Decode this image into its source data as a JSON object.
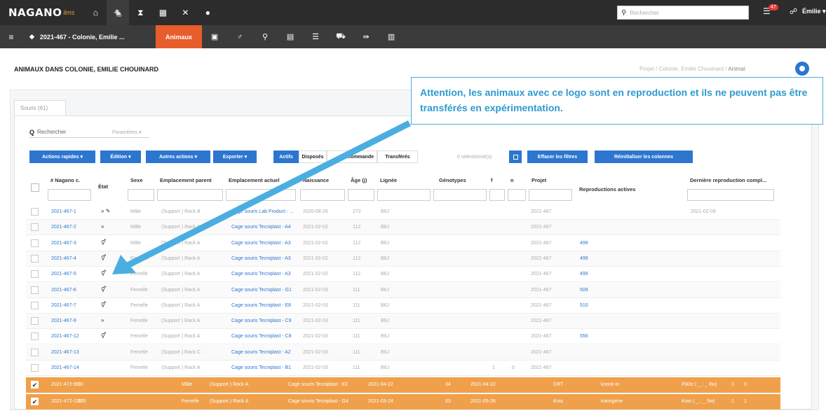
{
  "app": {
    "logo": "NAGANO",
    "logo_sub": "lims"
  },
  "topbar": {
    "icons": [
      "home-icon",
      "rodent-icon",
      "flask-icon",
      "grid-icon",
      "tools-icon",
      "help-icon"
    ],
    "search_placeholder": "Rechercher",
    "notif_count": "47",
    "user": "Émilie ▾"
  },
  "secbar": {
    "project": "2021-467 - Colonie, Emilie ...",
    "active_tab": "Animaux",
    "icons": [
      "calendar-icon",
      "male-icon",
      "location-icon",
      "calendar2-icon",
      "list-icon",
      "cart-icon",
      "transfer-icon",
      "report-icon"
    ]
  },
  "page": {
    "title": "ANIMAUX DANS COLONIE, EMILIE CHOUINARD",
    "breadcrumb": [
      "Projet",
      "Colonie, Emilie Chouinard",
      "Animal"
    ]
  },
  "tab": {
    "label": "Souris (61)"
  },
  "search": {
    "label": "Rechercher",
    "params": "Paramètres ▾"
  },
  "toolbar": {
    "actions_rapides": "Actions rapides ▾",
    "edition": "Édition ▾",
    "autres_actions": "Autres actions ▾",
    "exporter": "Exporter ▾",
    "actifs": "Actifs",
    "disposes": "Disposés",
    "commande": "commande",
    "transferes": "Transférés",
    "selected": "0 sélectionné(s)",
    "effacer": "Effacer les filtres",
    "reinit": "Réinitialiser les colonnes"
  },
  "headers": {
    "nagano": "# Nagano c.",
    "etat": "État",
    "sexe": "Sexe",
    "parent": "Emplacement parent",
    "actuel": "Emplacement actuel",
    "naissance": "Naissance",
    "age": "Âge (j)",
    "lignee": "Lignée",
    "genotypes": "Génotypes",
    "f": "f",
    "n": "n",
    "projet": "Projet",
    "repro": "Reproductions actives",
    "derniere": "Dernière reproduction compl..."
  },
  "rows": [
    {
      "id": "2021-467-1",
      "etat": "»  ✎",
      "sexe": "Mâle",
      "parent": "(Support ) Rack B",
      "actuel": "Cage souris Lab Product - ...",
      "naissance": "2020-08-26",
      "age": "272",
      "lignee": "B6J",
      "f": "",
      "n": "",
      "projet": "2021-467",
      "repro": "",
      "derniere": "2021-02-09"
    },
    {
      "id": "2021-467-2",
      "etat": "»",
      "sexe": "Mâle",
      "parent": "(Support ) Rack A",
      "actuel": "Cage souris Tecniplast - A4",
      "naissance": "2021-02-02",
      "age": "112",
      "lignee": "B6J",
      "f": "",
      "n": "",
      "projet": "2021-467",
      "repro": "",
      "derniere": ""
    },
    {
      "id": "2021-467-3",
      "etat": "⚥",
      "sexe": "Mâle",
      "parent": "(Support ) Rack A",
      "actuel": "Cage souris Tecniplast - A3",
      "naissance": "2021-02-02",
      "age": "112",
      "lignee": "B6J",
      "f": "",
      "n": "",
      "projet": "2021-467",
      "repro": "499",
      "derniere": ""
    },
    {
      "id": "2021-467-4",
      "etat": "⚥",
      "sexe": "Femelle",
      "parent": "(Support ) Rack A",
      "actuel": "Cage souris Tecniplast - A3",
      "naissance": "2021-02-02",
      "age": "112",
      "lignee": "B6J",
      "f": "",
      "n": "",
      "projet": "2021-467",
      "repro": "499",
      "derniere": ""
    },
    {
      "id": "2021-467-5",
      "etat": "⚥",
      "sexe": "Femelle",
      "parent": "(Support ) Rack A",
      "actuel": "Cage souris Tecniplast - A3",
      "naissance": "2021-02-02",
      "age": "112",
      "lignee": "B6J",
      "f": "",
      "n": "",
      "projet": "2021-467",
      "repro": "499",
      "derniere": ""
    },
    {
      "id": "2021-467-6",
      "etat": "⚥",
      "sexe": "Femelle",
      "parent": "(Support ) Rack A",
      "actuel": "Cage souris Tecniplast - G1",
      "naissance": "2021-02-03",
      "age": "111",
      "lignee": "B6J",
      "f": "",
      "n": "",
      "projet": "2021-467",
      "repro": "509",
      "derniere": ""
    },
    {
      "id": "2021-467-7",
      "etat": "⚥",
      "sexe": "Femelle",
      "parent": "(Support ) Rack A",
      "actuel": "Cage souris Tecniplast - E8",
      "naissance": "2021-02-03",
      "age": "111",
      "lignee": "B6J",
      "f": "",
      "n": "",
      "projet": "2021-467",
      "repro": "510",
      "derniere": ""
    },
    {
      "id": "2021-467-9",
      "etat": "»",
      "sexe": "Femelle",
      "parent": "(Support ) Rack A",
      "actuel": "Cage souris Tecniplast - C9",
      "naissance": "2021-02-03",
      "age": "111",
      "lignee": "B6J",
      "f": "",
      "n": "",
      "projet": "2021-467",
      "repro": "",
      "derniere": ""
    },
    {
      "id": "2021-467-12",
      "etat": "⚥",
      "sexe": "Femelle",
      "parent": "(Support ) Rack A",
      "actuel": "Cage souris Tecniplast - C8",
      "naissance": "2021-02-03",
      "age": "111",
      "lignee": "B6J",
      "f": "",
      "n": "",
      "projet": "2021-467",
      "repro": "556",
      "derniere": ""
    },
    {
      "id": "2021-467-13",
      "etat": "",
      "sexe": "Femelle",
      "parent": "(Support ) Rack C",
      "actuel": "Cage souris Tecniplast - A2",
      "naissance": "2021-02-03",
      "age": "111",
      "lignee": "B6J",
      "f": "",
      "n": "",
      "projet": "2021-467",
      "repro": "",
      "derniere": ""
    },
    {
      "id": "2021-467-14",
      "etat": "",
      "sexe": "Femelle",
      "parent": "(Support ) Rack A",
      "actuel": "Cage souris Tecniplast - B1",
      "naissance": "2021-02-03",
      "age": "111",
      "lignee": "B6J",
      "f": "1",
      "n": "0",
      "projet": "2021-467",
      "repro": "",
      "derniere": ""
    }
  ],
  "selected_rows": [
    {
      "id": "2021-472-90",
      "num": "90",
      "sexe": "Mâle",
      "parent": "(Support ) Rack A",
      "actuel": "Cage souris Tecniplast - E2",
      "naissance": "2021-04-22",
      "age": "34",
      "date2": "2021-04-22",
      "projet": "CRT",
      "type": "knock-in",
      "geno": "Fbl3c ( _ ; _ /tw)",
      "f": "1",
      "n": "0"
    },
    {
      "id": "2021-472-105",
      "num": "105",
      "sexe": "Femelle",
      "parent": "(Support ) Rack A",
      "actuel": "Cage souris Tecniplast - G4",
      "naissance": "2021-03-24",
      "age": "63",
      "date2": "2021-05-26",
      "projet": "Kras",
      "type": "transgène",
      "geno": "Kras ( _ ; _ /tw)",
      "f": "1",
      "n": "1"
    }
  ],
  "callout": {
    "text": "Attention, les animaux avec ce logo sont en reproduction et ils ne peuvent pas être transférés en expérimentation."
  },
  "colors": {
    "accent": "#2d76cf",
    "brand_orange": "#e85d2c",
    "selected": "#f0a04a",
    "callout_text": "#2e9ad0"
  }
}
